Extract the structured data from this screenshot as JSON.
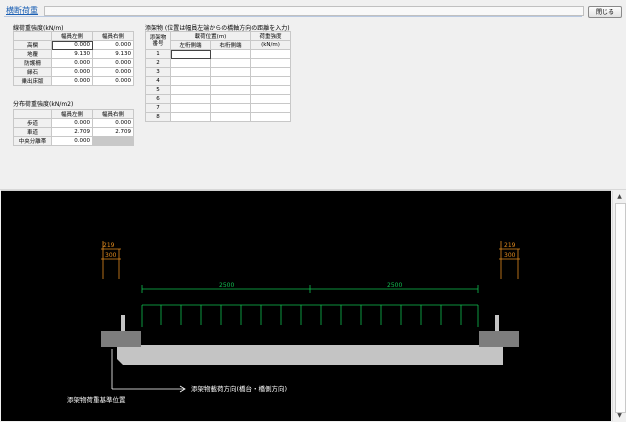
{
  "window": {
    "title": "横断荷重",
    "close_label": "閉じる"
  },
  "line_load": {
    "section_title": "線荷重強度(kN/m)",
    "headers": [
      "幅員左側",
      "幅員右側"
    ],
    "rows": [
      {
        "label": "高欄",
        "left": "0.000",
        "right": "0.000"
      },
      {
        "label": "地覆",
        "left": "9.130",
        "right": "9.130"
      },
      {
        "label": "防護柵",
        "left": "0.000",
        "right": "0.000"
      },
      {
        "label": "縁石",
        "left": "0.000",
        "right": "0.000"
      },
      {
        "label": "乗出床版",
        "left": "0.000",
        "right": "0.000"
      }
    ]
  },
  "dist_load": {
    "section_title": "分布荷重強度(kN/m2)",
    "headers": [
      "幅員左側",
      "幅員右側"
    ],
    "rows": [
      {
        "label": "歩道",
        "left": "0.000",
        "right": "0.000"
      },
      {
        "label": "車道",
        "left": "2.709",
        "right": "2.709"
      },
      {
        "label": "中央分離帯",
        "left": "0.000",
        "right": ""
      }
    ]
  },
  "attach": {
    "section_title": "添架物 (位置は幅員左端からの橋軸方向の距離を入力)",
    "col_no": "添架物番号",
    "col_pos": "載荷位置(m)",
    "col_left": "左桁側端",
    "col_right": "右桁側端",
    "col_load": "荷重強度",
    "col_unit": "(kN/m)",
    "rows": [
      "1",
      "2",
      "3",
      "4",
      "5",
      "6",
      "7",
      "8"
    ]
  },
  "drawing": {
    "dim_left_top": "219",
    "dim_left_bottom": "300",
    "dim_right_top": "219",
    "dim_right_bottom": "300",
    "span_left": "2500",
    "span_right": "2500",
    "arrow_label": "添架物載荷方向(橋台・橋側方向)",
    "ref_label": "添架物荷重基準位置",
    "colors": {
      "green": "#10c050",
      "orange": "#e08a1e",
      "gray": "#c4c4c4",
      "dark": "#7d7d7d",
      "white": "#ffffff"
    }
  }
}
